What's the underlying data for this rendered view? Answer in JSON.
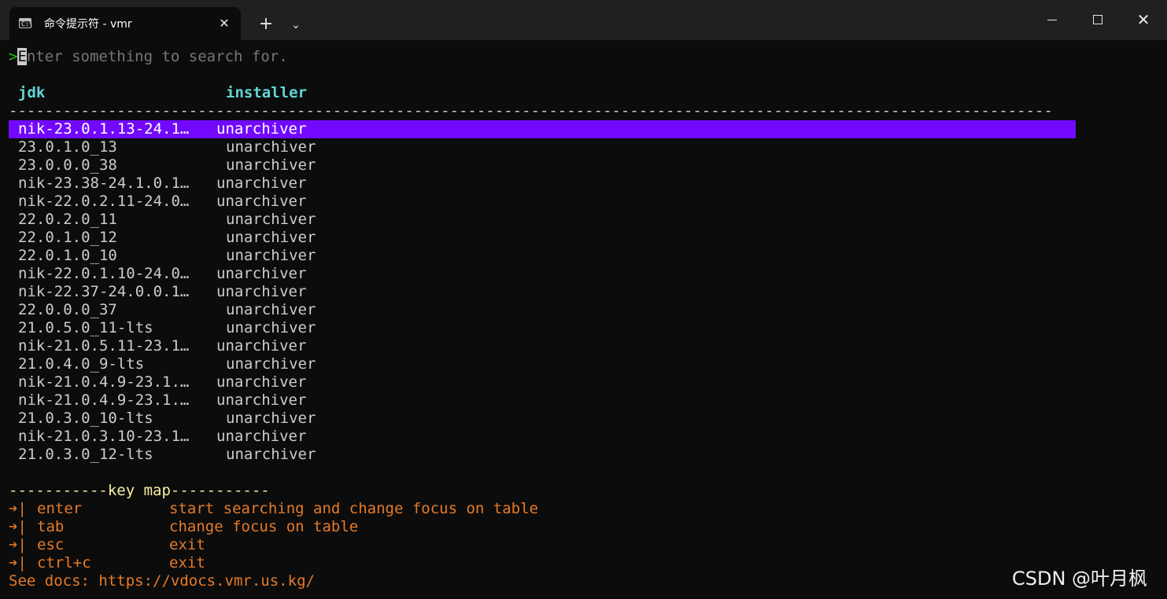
{
  "window": {
    "tab_title": "命令提示符 - vmr",
    "tab_icon_glyph": "C:\\",
    "close_tab": "✕",
    "new_tab": "+",
    "dropdown": "⌄",
    "close_window": "✕"
  },
  "prompt": {
    "chevron": ">",
    "cursor_char": "E",
    "placeholder_rest": "nter something to search for."
  },
  "table": {
    "headers": {
      "jdk": "jdk",
      "installer": "installer"
    },
    "separator": "--------------------------------------------------------------------------------------------------------------------",
    "selected_index": 0,
    "rows": [
      {
        "jdk": "nik-23.0.1.13-24.1…",
        "installer": "unarchiver"
      },
      {
        "jdk": "23.0.1.0_13",
        "installer": "unarchiver"
      },
      {
        "jdk": "23.0.0.0_38",
        "installer": "unarchiver"
      },
      {
        "jdk": "nik-23.38-24.1.0.1…",
        "installer": "unarchiver"
      },
      {
        "jdk": "nik-22.0.2.11-24.0…",
        "installer": "unarchiver"
      },
      {
        "jdk": "22.0.2.0_11",
        "installer": "unarchiver"
      },
      {
        "jdk": "22.0.1.0_12",
        "installer": "unarchiver"
      },
      {
        "jdk": "22.0.1.0_10",
        "installer": "unarchiver"
      },
      {
        "jdk": "nik-22.0.1.10-24.0…",
        "installer": "unarchiver"
      },
      {
        "jdk": "nik-22.37-24.0.0.1…",
        "installer": "unarchiver"
      },
      {
        "jdk": "22.0.0.0_37",
        "installer": "unarchiver"
      },
      {
        "jdk": "21.0.5.0_11-lts",
        "installer": "unarchiver"
      },
      {
        "jdk": "nik-21.0.5.11-23.1…",
        "installer": "unarchiver"
      },
      {
        "jdk": "21.0.4.0_9-lts",
        "installer": "unarchiver"
      },
      {
        "jdk": "nik-21.0.4.9-23.1.…",
        "installer": "unarchiver"
      },
      {
        "jdk": "nik-21.0.4.9-23.1.…",
        "installer": "unarchiver"
      },
      {
        "jdk": "21.0.3.0_10-lts",
        "installer": "unarchiver"
      },
      {
        "jdk": "nik-21.0.3.10-23.1…",
        "installer": "unarchiver"
      },
      {
        "jdk": "21.0.3.0_12-lts",
        "installer": "unarchiver"
      }
    ]
  },
  "keymap": {
    "title": "-----------key map-----------",
    "items": [
      {
        "arrow": "➔|",
        "key": "enter",
        "desc": "start searching and change focus on table"
      },
      {
        "arrow": "➔|",
        "key": "tab",
        "desc": "change focus on table"
      },
      {
        "arrow": "➔|",
        "key": "esc",
        "desc": "exit"
      },
      {
        "arrow": "➔|",
        "key": "ctrl+c",
        "desc": "exit"
      }
    ],
    "docs_label": "See docs:",
    "docs_url": "https://vdocs.vmr.us.kg/"
  },
  "watermark": "CSDN @叶月枫",
  "colors": {
    "selection": "#7209fe",
    "header": "#61d6d6",
    "keymap_title": "#f9f1a5",
    "keymap_text": "#e67a28",
    "prompt": "#16c60c"
  }
}
